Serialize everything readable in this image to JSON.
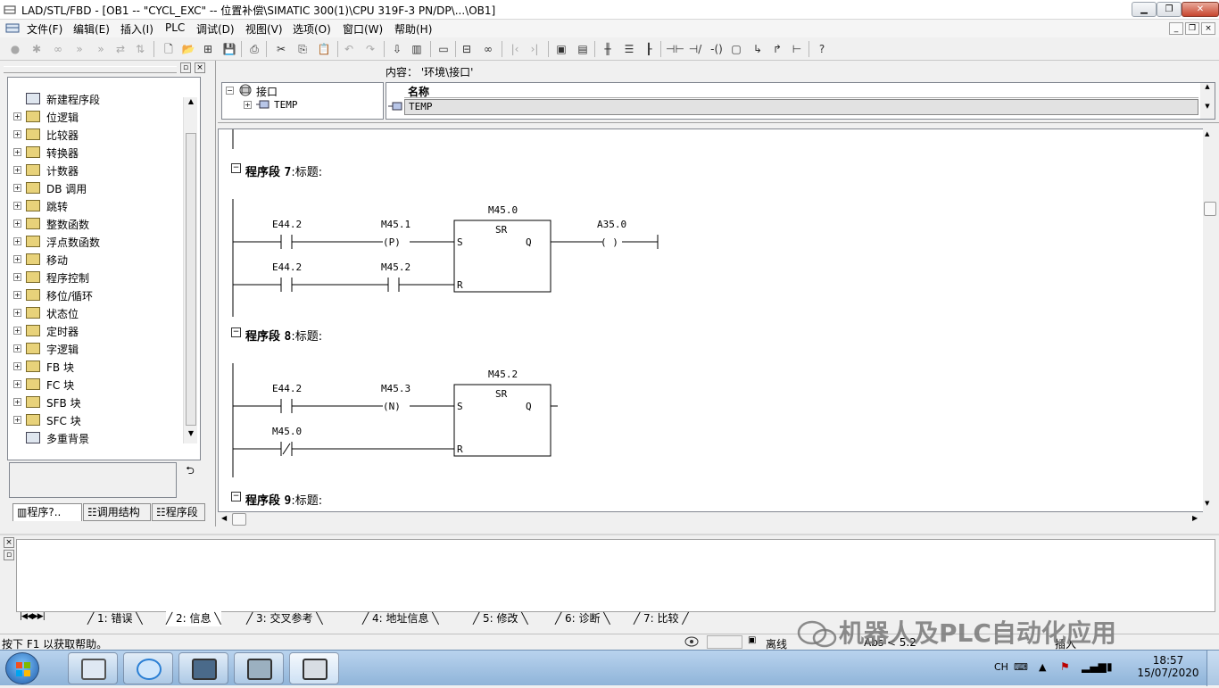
{
  "window": {
    "title": "LAD/STL/FBD  - [OB1 -- \"CYCL_EXC\" -- 位置补偿\\SIMATIC 300(1)\\CPU 319F-3 PN/DP\\...\\OB1]"
  },
  "menu": [
    "文件(F)",
    "编辑(E)",
    "插入(I)",
    "PLC",
    "调试(D)",
    "视图(V)",
    "选项(O)",
    "窗口(W)",
    "帮助(H)"
  ],
  "left_tree": {
    "items": [
      {
        "label": "新建程序段",
        "icon": "new-network-icon"
      },
      {
        "label": "位逻辑",
        "icon": "bit-logic-icon"
      },
      {
        "label": "比较器",
        "icon": "comparator-icon"
      },
      {
        "label": "转换器",
        "icon": "converter-icon"
      },
      {
        "label": "计数器",
        "icon": "counter-icon"
      },
      {
        "label": "DB 调用",
        "icon": "db-call-icon"
      },
      {
        "label": "跳转",
        "icon": "jump-icon"
      },
      {
        "label": "整数函数",
        "icon": "integer-math-icon"
      },
      {
        "label": "浮点数函数",
        "icon": "float-math-icon"
      },
      {
        "label": "移动",
        "icon": "move-icon"
      },
      {
        "label": "程序控制",
        "icon": "program-control-icon"
      },
      {
        "label": "移位/循环",
        "icon": "shift-rotate-icon"
      },
      {
        "label": "状态位",
        "icon": "status-bits-icon"
      },
      {
        "label": "定时器",
        "icon": "timer-icon"
      },
      {
        "label": "字逻辑",
        "icon": "word-logic-icon"
      },
      {
        "label": "FB 块",
        "icon": "fb-block-icon"
      },
      {
        "label": "FC 块",
        "icon": "fc-block-icon"
      },
      {
        "label": "SFB 块",
        "icon": "sfb-block-icon"
      },
      {
        "label": "SFC 块",
        "icon": "sfc-block-icon"
      },
      {
        "label": "多重背景",
        "icon": "multi-instance-icon"
      }
    ],
    "tabs": [
      "程序?..",
      "调用结构",
      "程序段"
    ]
  },
  "interface": {
    "root": "接口",
    "child": "TEMP",
    "content_label": "内容：  '环境\\接口'",
    "column_name": "名称",
    "row": "TEMP"
  },
  "networks": [
    {
      "title_prefix": "程序段",
      "number": "7",
      "title_suffix": ":标题:",
      "rung1": {
        "contact": "E44.2",
        "edge": "M45.1",
        "edge_type": "P"
      },
      "rung2": {
        "contact1": "E44.2",
        "contact2": "M45.2"
      },
      "block": {
        "address": "M45.0",
        "type": "SR",
        "set": "S",
        "reset": "R",
        "out": "Q"
      },
      "coil": "A35.0"
    },
    {
      "title_prefix": "程序段",
      "number": "8",
      "title_suffix": ":标题:",
      "rung1": {
        "contact": "E44.2",
        "edge": "M45.3",
        "edge_type": "N"
      },
      "rung2": {
        "contact_nc": "M45.0"
      },
      "block": {
        "address": "M45.2",
        "type": "SR",
        "set": "S",
        "reset": "R",
        "out": "Q"
      }
    },
    {
      "title_prefix": "程序段",
      "number": "9",
      "title_suffix": ":标题:"
    }
  ],
  "output_tabs": [
    "1: 错误",
    "2: 信息",
    "3: 交叉参考",
    "4: 地址信息",
    "5: 修改",
    "6: 诊断",
    "7: 比较"
  ],
  "status": {
    "help": "按下 F1 以获取帮助。",
    "mode": "离线",
    "abs": "Abs < 5.2",
    "insert": "插入",
    "watermark": "机器人及PLC自动化应用"
  },
  "taskbar": {
    "lang": "CH",
    "time": "18:57",
    "date": "15/07/2020"
  }
}
